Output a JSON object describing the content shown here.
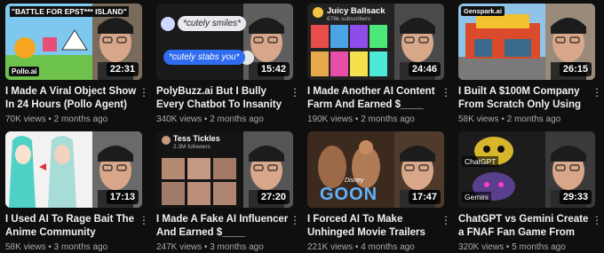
{
  "videos": [
    {
      "title": "I Made A Viral Object Show In 24 Hours (Pollo Agent)",
      "views": "70K views",
      "age": "2 months ago",
      "duration": "22:31",
      "thumb_text": "\"BATTLE FOR EPST*** ISLAND\"",
      "thumb_badge": "Pollo.ai"
    },
    {
      "title": "PolyBuzz.ai But I Bully Every Chatbot To Insanity 😈",
      "views": "340K views",
      "age": "2 months ago",
      "duration": "15:42",
      "thumb_text": "*cutely smiles*",
      "thumb_text2": "*cutely stabs you*"
    },
    {
      "title": "I Made Another AI Content Farm And Earned $____",
      "views": "190K views",
      "age": "2 months ago",
      "duration": "24:46",
      "thumb_text": "Juicy Ballsack",
      "thumb_text2": "676k subscribers"
    },
    {
      "title": "I Built A $100M Company From Scratch Only Using AI ...",
      "views": "58K views",
      "age": "2 months ago",
      "duration": "26:15",
      "thumb_text": "Genspark.ai"
    },
    {
      "title": "I Used AI To Rage Bait The Anime Community",
      "views": "58K views",
      "age": "3 months ago",
      "duration": "17:13"
    },
    {
      "title": "I Made A Fake AI Influencer And Earned $____",
      "views": "247K views",
      "age": "3 months ago",
      "duration": "27:20",
      "thumb_text": "Tess Tickles",
      "thumb_text2": "2.3M followers"
    },
    {
      "title": "I Forced AI To Make Unhinged Movie Trailers",
      "views": "221K views",
      "age": "4 months ago",
      "duration": "17:47",
      "thumb_text": "Disney",
      "thumb_text2": "GOON"
    },
    {
      "title": "ChatGPT vs Gemini Create a FNAF Fan Game From Scratch",
      "views": "320K views",
      "age": "5 months ago",
      "duration": "29:33",
      "thumb_text": "ChatGPT",
      "thumb_text2": "Gemini"
    }
  ],
  "menu_icon": "more-vertical-icon",
  "colors": {
    "background": "#0f0f0f",
    "meta": "#aaaaaa"
  }
}
